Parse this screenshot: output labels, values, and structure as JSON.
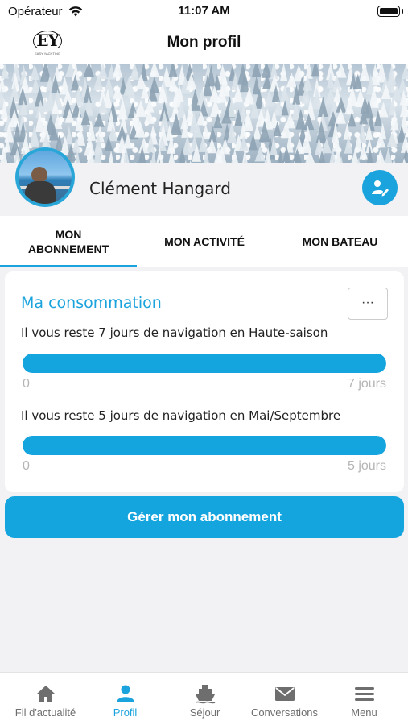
{
  "status_bar": {
    "carrier": "Opérateur",
    "time": "11:07 AM"
  },
  "nav": {
    "logo": "EY",
    "logo_sub": "EASY YACHTING",
    "title": "Mon profil"
  },
  "profile": {
    "name": "Clément Hangard"
  },
  "tabs": [
    {
      "label": "MON\nABONNEMENT",
      "active": true
    },
    {
      "label": "MON ACTIVITÉ",
      "active": false
    },
    {
      "label": "MON BATEAU",
      "active": false
    }
  ],
  "consumption": {
    "title": "Ma consommation",
    "more_label": "···",
    "items": [
      {
        "text": "Il vous reste 7 jours de navigation en Haute-saison",
        "min": "0",
        "max": "7 jours",
        "remaining_fraction": 1.0
      },
      {
        "text": "Il vous reste 5 jours de navigation en Mai/Septembre",
        "min": "0",
        "max": "5 jours",
        "remaining_fraction": 1.0
      }
    ]
  },
  "manage_button": "Gérer mon abonnement",
  "tabbar": [
    {
      "label": "Fil d'actualité",
      "icon": "home-icon",
      "active": false
    },
    {
      "label": "Profil",
      "icon": "person-icon",
      "active": true
    },
    {
      "label": "Séjour",
      "icon": "boat-icon",
      "active": false
    },
    {
      "label": "Conversations",
      "icon": "envelope-icon",
      "active": false
    },
    {
      "label": "Menu",
      "icon": "hamburger-icon",
      "active": false
    }
  ],
  "colors": {
    "accent": "#1aa3dc",
    "bar": "#14a4de",
    "muted": "#b5b5b5"
  }
}
